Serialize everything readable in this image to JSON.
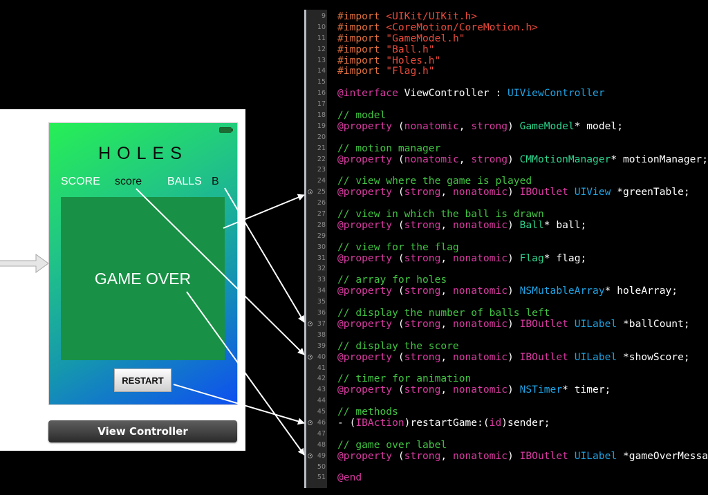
{
  "storyboard": {
    "title": "HOLES",
    "score_label": "SCORE",
    "score_value": "score",
    "balls_label": "BALLS",
    "balls_value": "B",
    "game_over": "GAME OVER",
    "restart_button": "RESTART",
    "controller_name": "View Controller"
  },
  "colors": {
    "table_green": "#189146",
    "gradient_top": "#27ef55",
    "gradient_bottom": "#0e4ff0",
    "keyword": "#d83aa1",
    "comment": "#41c443",
    "preprocessor": "#e2703f",
    "string": "#ea4a3c",
    "project_type": "#2ed58e",
    "system_type": "#1ea3e4"
  },
  "editor": {
    "lines": [
      {
        "n": "9",
        "tokens": [
          [
            "#import ",
            "imp"
          ],
          [
            "<UIKit/UIKit.h>",
            "str"
          ]
        ]
      },
      {
        "n": "10",
        "tokens": [
          [
            "#import ",
            "imp"
          ],
          [
            "<CoreMotion/CoreMotion.h>",
            "str"
          ]
        ]
      },
      {
        "n": "11",
        "tokens": [
          [
            "#import ",
            "imp"
          ],
          [
            "\"GameModel.h\"",
            "str"
          ]
        ]
      },
      {
        "n": "12",
        "tokens": [
          [
            "#import ",
            "imp"
          ],
          [
            "\"Ball.h\"",
            "str"
          ]
        ]
      },
      {
        "n": "13",
        "tokens": [
          [
            "#import ",
            "imp"
          ],
          [
            "\"Holes.h\"",
            "str"
          ]
        ]
      },
      {
        "n": "14",
        "tokens": [
          [
            "#import ",
            "imp"
          ],
          [
            "\"Flag.h\"",
            "str"
          ]
        ]
      },
      {
        "n": "15",
        "tokens": []
      },
      {
        "n": "16",
        "tokens": [
          [
            "@interface",
            "kw"
          ],
          [
            " ViewController : ",
            "pl"
          ],
          [
            "UIViewController",
            "sys"
          ]
        ]
      },
      {
        "n": "17",
        "tokens": []
      },
      {
        "n": "18",
        "tokens": [
          [
            "// model",
            "cm"
          ]
        ]
      },
      {
        "n": "19",
        "tokens": [
          [
            "@property",
            "kw"
          ],
          [
            " (",
            "pl"
          ],
          [
            "nonatomic",
            "kw"
          ],
          [
            ", ",
            "pl"
          ],
          [
            "strong",
            "kw"
          ],
          [
            ") ",
            "pl"
          ],
          [
            "GameModel",
            "proj"
          ],
          [
            "* model;",
            "pl"
          ]
        ]
      },
      {
        "n": "20",
        "tokens": []
      },
      {
        "n": "21",
        "tokens": [
          [
            "// motion manager",
            "cm"
          ]
        ]
      },
      {
        "n": "22",
        "tokens": [
          [
            "@property",
            "kw"
          ],
          [
            " (",
            "pl"
          ],
          [
            "nonatomic",
            "kw"
          ],
          [
            ", ",
            "pl"
          ],
          [
            "strong",
            "kw"
          ],
          [
            ") ",
            "pl"
          ],
          [
            "CMMotionManager",
            "proj"
          ],
          [
            "* motionManager;",
            "pl"
          ]
        ]
      },
      {
        "n": "23",
        "tokens": []
      },
      {
        "n": "24",
        "tokens": [
          [
            "// view where the game is played",
            "cm"
          ]
        ]
      },
      {
        "n": "25",
        "outlet": true,
        "tokens": [
          [
            "@property",
            "kw"
          ],
          [
            " (",
            "pl"
          ],
          [
            "strong",
            "kw"
          ],
          [
            ", ",
            "pl"
          ],
          [
            "nonatomic",
            "kw"
          ],
          [
            ") ",
            "pl"
          ],
          [
            "IBOutlet",
            "kw"
          ],
          [
            " ",
            "pl"
          ],
          [
            "UIView",
            "sys"
          ],
          [
            " *greenTable;",
            "pl"
          ]
        ]
      },
      {
        "n": "26",
        "tokens": []
      },
      {
        "n": "27",
        "tokens": [
          [
            "// view in which the ball is drawn",
            "cm"
          ]
        ]
      },
      {
        "n": "28",
        "tokens": [
          [
            "@property",
            "kw"
          ],
          [
            " (",
            "pl"
          ],
          [
            "strong",
            "kw"
          ],
          [
            ", ",
            "pl"
          ],
          [
            "nonatomic",
            "kw"
          ],
          [
            ") ",
            "pl"
          ],
          [
            "Ball",
            "proj"
          ],
          [
            "* ball;",
            "pl"
          ]
        ]
      },
      {
        "n": "29",
        "tokens": []
      },
      {
        "n": "30",
        "tokens": [
          [
            "// view for the flag",
            "cm"
          ]
        ]
      },
      {
        "n": "31",
        "tokens": [
          [
            "@property",
            "kw"
          ],
          [
            " (",
            "pl"
          ],
          [
            "strong",
            "kw"
          ],
          [
            ", ",
            "pl"
          ],
          [
            "nonatomic",
            "kw"
          ],
          [
            ") ",
            "pl"
          ],
          [
            "Flag",
            "proj"
          ],
          [
            "* flag;",
            "pl"
          ]
        ]
      },
      {
        "n": "32",
        "tokens": []
      },
      {
        "n": "33",
        "tokens": [
          [
            "// array for holes",
            "cm"
          ]
        ]
      },
      {
        "n": "34",
        "tokens": [
          [
            "@property",
            "kw"
          ],
          [
            " (",
            "pl"
          ],
          [
            "strong",
            "kw"
          ],
          [
            ", ",
            "pl"
          ],
          [
            "nonatomic",
            "kw"
          ],
          [
            ") ",
            "pl"
          ],
          [
            "NSMutableArray",
            "sys"
          ],
          [
            "* holeArray;",
            "pl"
          ]
        ]
      },
      {
        "n": "35",
        "tokens": []
      },
      {
        "n": "36",
        "tokens": [
          [
            "// display the number of balls left",
            "cm"
          ]
        ]
      },
      {
        "n": "37",
        "outlet": true,
        "tokens": [
          [
            "@property",
            "kw"
          ],
          [
            " (",
            "pl"
          ],
          [
            "strong",
            "kw"
          ],
          [
            ", ",
            "pl"
          ],
          [
            "nonatomic",
            "kw"
          ],
          [
            ") ",
            "pl"
          ],
          [
            "IBOutlet",
            "kw"
          ],
          [
            " ",
            "pl"
          ],
          [
            "UILabel",
            "sys"
          ],
          [
            " *ballCount;",
            "pl"
          ]
        ]
      },
      {
        "n": "38",
        "tokens": []
      },
      {
        "n": "39",
        "tokens": [
          [
            "// display the score",
            "cm"
          ]
        ]
      },
      {
        "n": "40",
        "outlet": true,
        "tokens": [
          [
            "@property",
            "kw"
          ],
          [
            " (",
            "pl"
          ],
          [
            "strong",
            "kw"
          ],
          [
            ", ",
            "pl"
          ],
          [
            "nonatomic",
            "kw"
          ],
          [
            ") ",
            "pl"
          ],
          [
            "IBOutlet",
            "kw"
          ],
          [
            " ",
            "pl"
          ],
          [
            "UILabel",
            "sys"
          ],
          [
            " *showScore;",
            "pl"
          ]
        ]
      },
      {
        "n": "41",
        "tokens": []
      },
      {
        "n": "42",
        "tokens": [
          [
            "// timer for animation",
            "cm"
          ]
        ]
      },
      {
        "n": "43",
        "tokens": [
          [
            "@property",
            "kw"
          ],
          [
            " (",
            "pl"
          ],
          [
            "strong",
            "kw"
          ],
          [
            ", ",
            "pl"
          ],
          [
            "nonatomic",
            "kw"
          ],
          [
            ") ",
            "pl"
          ],
          [
            "NSTimer",
            "sys"
          ],
          [
            "* timer;",
            "pl"
          ]
        ]
      },
      {
        "n": "44",
        "tokens": []
      },
      {
        "n": "45",
        "tokens": [
          [
            "// methods",
            "cm"
          ]
        ]
      },
      {
        "n": "46",
        "outlet": true,
        "tokens": [
          [
            "- (",
            "pl"
          ],
          [
            "IBAction",
            "kw"
          ],
          [
            ")restartGame:(",
            "pl"
          ],
          [
            "id",
            "kw"
          ],
          [
            ")sender;",
            "pl"
          ]
        ]
      },
      {
        "n": "47",
        "tokens": []
      },
      {
        "n": "48",
        "tokens": [
          [
            "// game over label",
            "cm"
          ]
        ]
      },
      {
        "n": "49",
        "outlet": true,
        "tokens": [
          [
            "@property",
            "kw"
          ],
          [
            " (",
            "pl"
          ],
          [
            "strong",
            "kw"
          ],
          [
            ", ",
            "pl"
          ],
          [
            "nonatomic",
            "kw"
          ],
          [
            ") ",
            "pl"
          ],
          [
            "IBOutlet",
            "kw"
          ],
          [
            " ",
            "pl"
          ],
          [
            "UILabel",
            "sys"
          ],
          [
            " *gameOverMessage;",
            "pl"
          ]
        ]
      },
      {
        "n": "50",
        "tokens": []
      },
      {
        "n": "51",
        "tokens": [
          [
            "@end",
            "kw"
          ]
        ]
      }
    ]
  }
}
